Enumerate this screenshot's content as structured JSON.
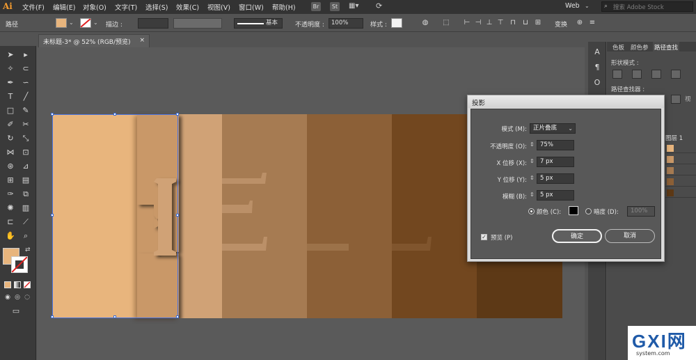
{
  "app": {
    "logo": "Ai"
  },
  "menubar": {
    "items": [
      "文件(F)",
      "编辑(E)",
      "对象(O)",
      "文字(T)",
      "选择(S)",
      "效果(C)",
      "视图(V)",
      "窗口(W)",
      "帮助(H)"
    ],
    "badges": [
      "Br",
      "St"
    ],
    "workspace": "Web",
    "search_placeholder": "搜索 Adobe Stock"
  },
  "controlbar": {
    "path_label": "路径",
    "stroke_label": "描边 :",
    "stroke_style": "基本",
    "opacity_label": "不透明度 :",
    "opacity_value": "100%",
    "style_label": "样式 :",
    "transform_label": "变换"
  },
  "document": {
    "tab_title": "未标题-3* @ 52% (RGB/预览)",
    "close": "×"
  },
  "colors": {
    "fill": "#e8b57d",
    "bands": [
      "#e8b57d",
      "#c99868",
      "#d0a276",
      "#a67b52",
      "#8c6037",
      "#72471f",
      "#5d3916"
    ]
  },
  "artboard": {
    "letters": [
      "H",
      "E",
      "L",
      "L"
    ]
  },
  "rightpanel": {
    "tabs": [
      "色板",
      "颜色参",
      "路径查找"
    ],
    "shape_modes_label": "形状模式 :",
    "pathfinder_label": "路径查找器 :",
    "layers_tab": "视",
    "layer_name": "图层 1",
    "layer_rows": 5
  },
  "dialog": {
    "title": "投影",
    "mode_label": "模式 (M):",
    "mode_value": "正片叠底",
    "opacity_label": "不透明度 (O):",
    "opacity_value": "75%",
    "x_label": "X 位移 (X):",
    "x_value": "7 px",
    "y_label": "Y 位移 (Y):",
    "y_value": "5 px",
    "blur_label": "模糊 (B):",
    "blur_value": "5 px",
    "color_label": "颜色 (C):",
    "darkness_label": "暗度 (D):",
    "darkness_value": "100%",
    "preview_label": "预览 (P)",
    "ok_label": "确定",
    "cancel_label": "取消"
  },
  "watermark": {
    "logo": "GXI网",
    "site": "system.com"
  }
}
